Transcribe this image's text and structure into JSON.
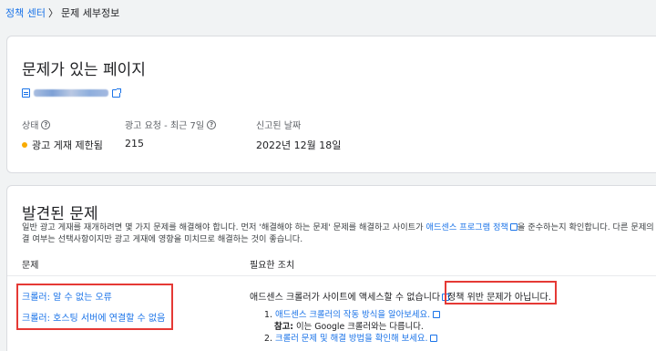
{
  "breadcrumb": {
    "parent": "정책 센터",
    "separator": "〉",
    "current": "문제 세부정보"
  },
  "page_card": {
    "title": "문제가 있는 페이지",
    "icons": {
      "page": "document-icon",
      "open": "external-link-icon"
    },
    "status_label": "상태",
    "requests_label": "광고 요청 - 최근 7일",
    "reported_label": "신고된 날짜",
    "status_value": "광고 게재 제한됨",
    "requests_value": "215",
    "reported_value": "2022년 12월 18일",
    "status_color": "#f9ab00"
  },
  "issues_card": {
    "title": "발견된 문제",
    "desc_part1": "일반 광고 게재를 재개하려면 몇 가지 문제를 해결해야 합니다. 먼저 '해결해야 하는 문제' 문제를 해결하고 사이트가 ",
    "desc_link": "애드센스 프로그램 정책",
    "desc_part2": "을 준수하는지 확인합니다. 다른 문제의 해결 여부는 선택사항이지만 광고 게재에 영향을 미치므로 해결하는 것이 좋습니다.",
    "col_issue": "문제",
    "col_action": "필요한 조치",
    "issue_1": "크롤러: 알 수 없는 오류",
    "issue_2": "크롤러: 호스팅 서버에 연결할 수 없음",
    "action_text": "애드센스 크롤러가 사이트에 액세스할 수 없습니다",
    "action_highlight": "정책 위반 문제가 아닙니다.",
    "step1_num": "1.",
    "step1_link": "애드센스 크롤러의 작동 방식을 알아보세요.",
    "note_label": "참고:",
    "note_text": " 이는 Google 크롤러와는 다릅니다.",
    "step2_num": "2.",
    "step2_link": "크롤러 문제 및 해결 방법을 확인해 보세요.",
    "accent_color": "#1a73e8",
    "highlight_color": "#e53935"
  }
}
